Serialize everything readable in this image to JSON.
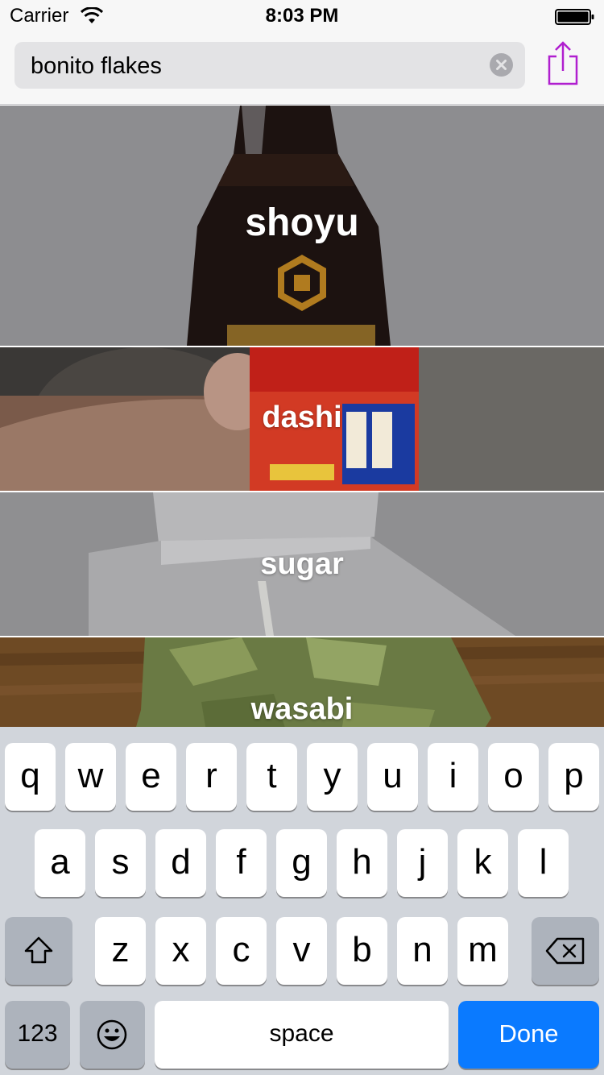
{
  "status_bar": {
    "carrier": "Carrier",
    "time": "8:03 PM",
    "wifi_icon": "wifi-icon",
    "battery_icon": "battery-icon"
  },
  "search": {
    "value": "bonito flakes",
    "clear_icon": "clear-icon",
    "share_icon": "share-icon",
    "share_color": "#b01fcf"
  },
  "ingredients": [
    {
      "label": "shoyu"
    },
    {
      "label": "dashi"
    },
    {
      "label": "sugar"
    },
    {
      "label": "wasabi"
    }
  ],
  "keyboard": {
    "row1": [
      "q",
      "w",
      "e",
      "r",
      "t",
      "y",
      "u",
      "i",
      "o",
      "p"
    ],
    "row2": [
      "a",
      "s",
      "d",
      "f",
      "g",
      "h",
      "j",
      "k",
      "l"
    ],
    "row3": [
      "z",
      "x",
      "c",
      "v",
      "b",
      "n",
      "m"
    ],
    "numbers_label": "123",
    "space_label": "space",
    "done_label": "Done",
    "done_color": "#0a7aff",
    "shift_icon": "shift-icon",
    "delete_icon": "delete-icon",
    "emoji_icon": "emoji-icon"
  }
}
